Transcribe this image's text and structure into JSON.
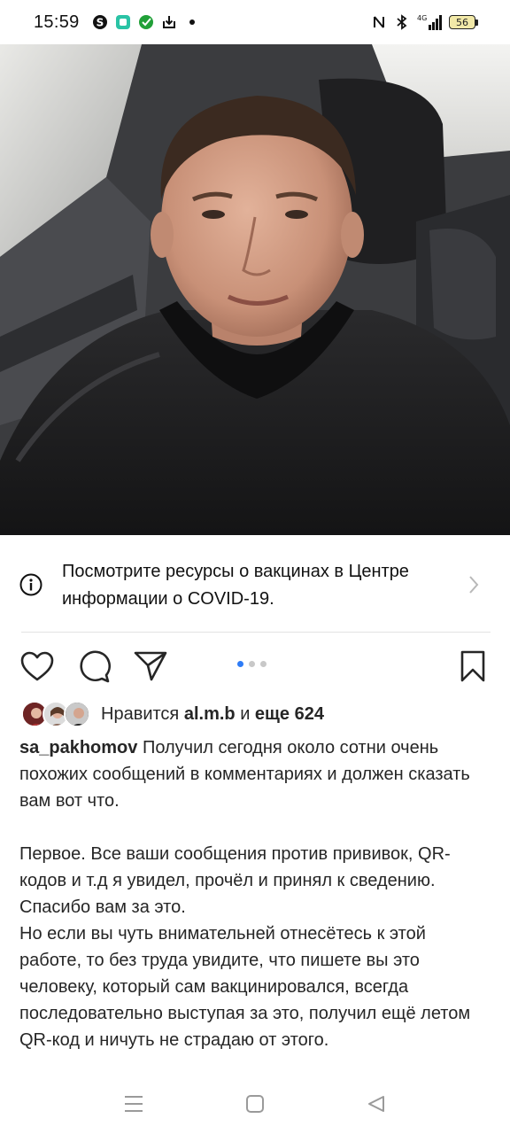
{
  "status_bar": {
    "time": "15:59",
    "network": "4G",
    "battery": "56",
    "left_icons": [
      "skype-icon",
      "app-icon",
      "sberbank-icon",
      "download-icon"
    ],
    "right_icons": [
      "nfc-icon",
      "bluetooth-icon",
      "signal-icon",
      "battery-icon"
    ]
  },
  "post": {
    "photo": {
      "description_icon": "selfie-photo"
    },
    "covid_banner": {
      "text": "Посмотрите ресурсы о вакцинах в Центре информации о COVID-19."
    },
    "carousel": {
      "count": 3,
      "active_index": 0,
      "active_color": "#2e7cf6"
    },
    "likes": {
      "prefix": "Нравится",
      "user": "al.m.b",
      "connector": "и",
      "others": "еще 624"
    },
    "caption": {
      "username": "sa_pakhomov",
      "paragraph1": "Получил сегодня около сотни очень похожих сообщений в комментариях и должен сказать вам вот что.",
      "paragraph2": "Первое. Все ваши сообщения против прививок, QR-кодов и т.д я увидел, прочёл и принял к сведению. Спасибо вам за это.",
      "paragraph3": "Но если вы чуть внимательней отнесётесь к этой работе, то без труда увидите, что  пишете вы это человеку, который сам вакцинировался, всегда последовательно выступая за это, получил ещё летом QR-код и ничуть не страдаю от этого."
    }
  },
  "navigation_bar": {
    "icons": [
      "menu-icon",
      "home-square-icon",
      "back-triangle-icon"
    ]
  }
}
